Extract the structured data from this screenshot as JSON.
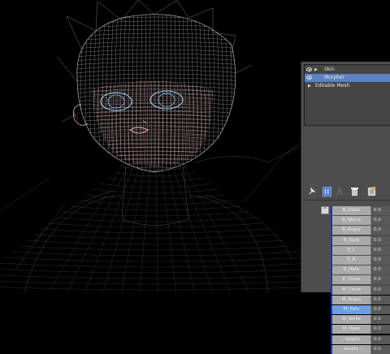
{
  "modifier_stack": [
    {
      "label": "Skin",
      "has_eye": true,
      "has_arrow": true,
      "selected": false
    },
    {
      "label": "Morpher",
      "has_eye": true,
      "has_arrow": false,
      "selected": true
    },
    {
      "label": "Editable Mesh",
      "has_eye": false,
      "has_arrow": true,
      "selected": false
    }
  ],
  "toolbar": {
    "icons": [
      "pin-stack-icon",
      "show-end-result-icon",
      "make-unique-icon",
      "remove-modifier-icon",
      "configure-modifier-sets-icon"
    ]
  },
  "channels_scroll_label": "^",
  "channels": [
    {
      "name": "B_Down",
      "value": "0.0",
      "active": false
    },
    {
      "name": "B_Worry",
      "value": "0.0",
      "active": false
    },
    {
      "name": "B_Angry",
      "value": "0.0",
      "active": false
    },
    {
      "name": "B_Surp",
      "value": "0.0",
      "active": false
    },
    {
      "name": "E_L",
      "value": "0.0",
      "active": false
    },
    {
      "name": "E_R",
      "value": "0.0",
      "active": false
    },
    {
      "name": "E_Hate",
      "value": "0.0",
      "active": false
    },
    {
      "name": "E_Close",
      "value": "0.0",
      "active": false
    },
    {
      "name": "M_Circle",
      "value": "0.0",
      "active": false
    },
    {
      "name": "M_Angry",
      "value": "0.0",
      "active": false
    },
    {
      "name": "M_Pain",
      "value": "0.0",
      "active": true
    },
    {
      "name": "M_Smile",
      "value": "0.0",
      "active": false
    },
    {
      "name": "M_Open",
      "value": "0.0",
      "active": false
    },
    {
      "name": "- empty",
      "value": "0.0",
      "active": false
    },
    {
      "name": "- empty -",
      "value": "0.0",
      "active": false
    }
  ],
  "colors": {
    "viewport_bg": "#000000",
    "wire": "#cfcfcf",
    "selection": "#5b82c4",
    "channel_active": "#6f9ee0",
    "channel_marker": "#1d2fcf"
  }
}
